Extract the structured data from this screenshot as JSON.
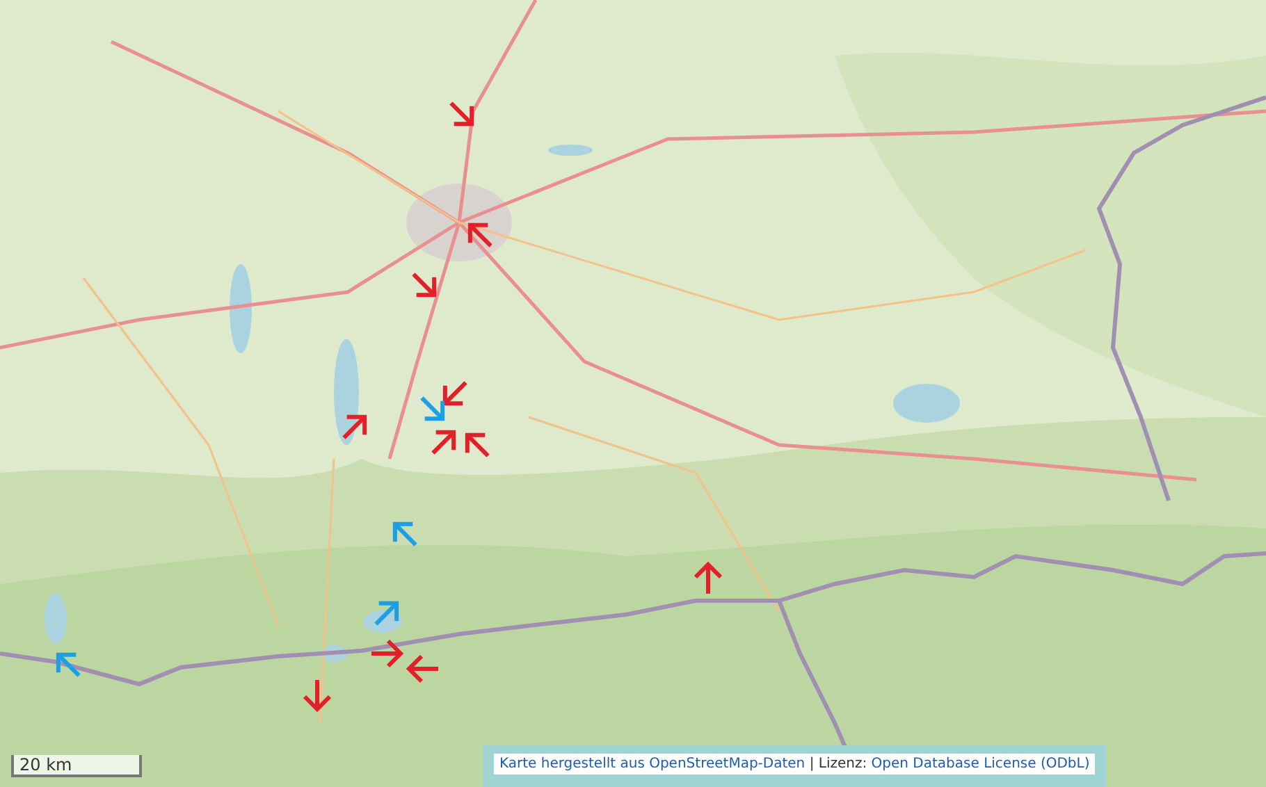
{
  "map": {
    "markers": [
      {
        "color": "#e3202a",
        "kind": "southeast"
      },
      {
        "color": "#e3202a",
        "kind": "northwest"
      },
      {
        "color": "#e3202a",
        "kind": "southeast"
      },
      {
        "color": "#e3202a",
        "kind": "northeast"
      },
      {
        "color": "#e3202a",
        "kind": "southwest"
      },
      {
        "color": "#1d9fe6",
        "kind": "southeast"
      },
      {
        "color": "#e3202a",
        "kind": "northeast"
      },
      {
        "color": "#e3202a",
        "kind": "northwest"
      },
      {
        "color": "#1d9fe6",
        "kind": "northwest"
      },
      {
        "color": "#1d9fe6",
        "kind": "northeast"
      },
      {
        "color": "#e3202a",
        "kind": "north"
      },
      {
        "color": "#e3202a",
        "kind": "east"
      },
      {
        "color": "#e3202a",
        "kind": "west"
      },
      {
        "color": "#e3202a",
        "kind": "south"
      },
      {
        "color": "#1d9fe6",
        "kind": "northwest"
      }
    ],
    "scale_bar": {
      "label": "20 km"
    },
    "attribution": {
      "source_link": "Karte hergestellt aus OpenStreetMap-Daten",
      "license_label": "| Lizenz:",
      "license_link": "Open Database License (ODbL)"
    }
  }
}
